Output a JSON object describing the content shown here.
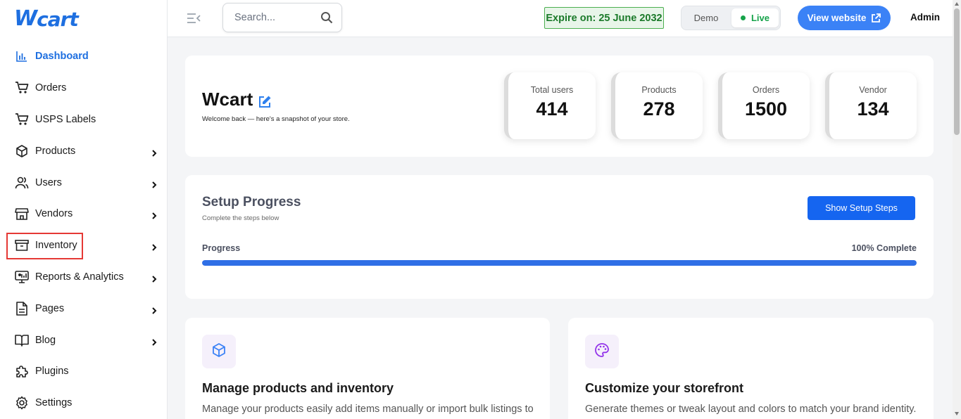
{
  "brand": {
    "logo_first": "W",
    "logo_rest": "cart"
  },
  "sidebar": {
    "items": [
      {
        "label": "Dashboard",
        "icon": "chart-bars-icon",
        "active": true,
        "has_children": false
      },
      {
        "label": "Orders",
        "icon": "cart-icon",
        "has_children": false
      },
      {
        "label": "USPS Labels",
        "icon": "cart-icon",
        "has_children": false
      },
      {
        "label": "Products",
        "icon": "box-icon",
        "has_children": true
      },
      {
        "label": "Users",
        "icon": "users-icon",
        "has_children": true
      },
      {
        "label": "Vendors",
        "icon": "store-icon",
        "has_children": true
      },
      {
        "label": "Inventory",
        "icon": "archive-icon",
        "has_children": true
      },
      {
        "label": "Reports & Analytics",
        "icon": "monitor-chart-icon",
        "has_children": true
      },
      {
        "label": "Pages",
        "icon": "document-icon",
        "has_children": true
      },
      {
        "label": "Blog",
        "icon": "book-icon",
        "has_children": true
      },
      {
        "label": "Plugins",
        "icon": "puzzle-icon",
        "has_children": false
      },
      {
        "label": "Settings",
        "icon": "gear-icon",
        "has_children": false
      }
    ]
  },
  "topbar": {
    "search_placeholder": "Search...",
    "expire_text": "Expire on: 25 June 2032",
    "mode_demo": "Demo",
    "mode_live": "Live",
    "view_website": "View website",
    "admin": "Admin"
  },
  "hero": {
    "title": "Wcart",
    "subtitle": "Welcome back — here's a snapshot of your store.",
    "stats": [
      {
        "label": "Total users",
        "value": "414"
      },
      {
        "label": "Products",
        "value": "278"
      },
      {
        "label": "Orders",
        "value": "1500"
      },
      {
        "label": "Vendor",
        "value": "134"
      }
    ]
  },
  "setup": {
    "title": "Setup Progress",
    "subtitle": "Complete the steps below",
    "button": "Show Setup Steps",
    "progress_label": "Progress",
    "progress_text": "100% Complete",
    "progress_fraction": 1.0
  },
  "features": [
    {
      "title": "Manage products and inventory",
      "description": "Manage your products easily add items manually or import bulk listings to",
      "icon": "cube-icon"
    },
    {
      "title": "Customize your storefront",
      "description": "Generate themes or tweak layout and colors to match your brand identity.",
      "icon": "palette-icon"
    }
  ],
  "colors": {
    "accent": "#1e6fe0",
    "live": "#16a34a",
    "expire_bg": "#e8f5e9",
    "highlight": "#e53935"
  }
}
